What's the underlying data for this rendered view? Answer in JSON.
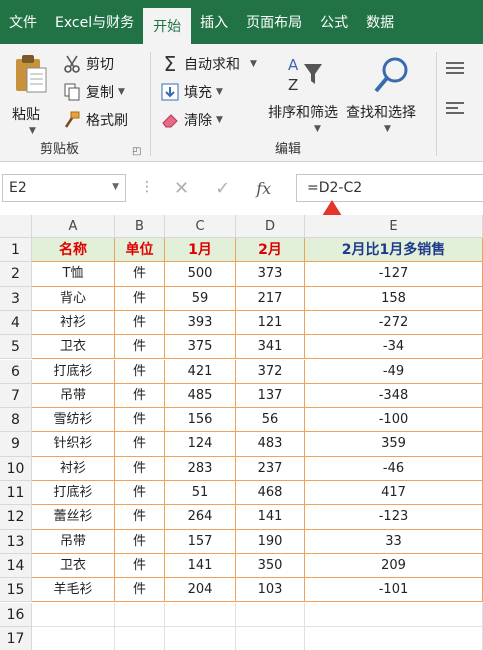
{
  "ribbon_tabs": [
    "文件",
    "Excel与财务",
    "开始",
    "插入",
    "页面布局",
    "公式",
    "数据"
  ],
  "active_tab_index": 2,
  "clipboard": {
    "paste": "粘贴",
    "cut": "剪切",
    "copy": "复制",
    "format_painter": "格式刷",
    "group_label": "剪贴板"
  },
  "editing": {
    "autosum": "自动求和",
    "fill": "填充",
    "clear": "清除",
    "sort_filter": "排序和筛选",
    "find_select": "查找和选择",
    "group_label": "编辑"
  },
  "formula_bar": {
    "name_box": "E2",
    "fx": "fx",
    "formula": "=D2-C2"
  },
  "sheet": {
    "columns": [
      "A",
      "B",
      "C",
      "D",
      "E"
    ],
    "header": [
      "名称",
      "单位",
      "1月",
      "2月",
      "2月比1月多销售"
    ],
    "rows": [
      [
        "T恤",
        "件",
        "500",
        "373",
        "-127"
      ],
      [
        "背心",
        "件",
        "59",
        "217",
        "158"
      ],
      [
        "衬衫",
        "件",
        "393",
        "121",
        "-272"
      ],
      [
        "卫衣",
        "件",
        "375",
        "341",
        "-34"
      ],
      [
        "打底衫",
        "件",
        "421",
        "372",
        "-49"
      ],
      [
        "吊带",
        "件",
        "485",
        "137",
        "-348"
      ],
      [
        "雪纺衫",
        "件",
        "156",
        "56",
        "-100"
      ],
      [
        "针织衫",
        "件",
        "124",
        "483",
        "359"
      ],
      [
        "衬衫",
        "件",
        "283",
        "237",
        "-46"
      ],
      [
        "打底衫",
        "件",
        "51",
        "468",
        "417"
      ],
      [
        "蕾丝衫",
        "件",
        "264",
        "141",
        "-123"
      ],
      [
        "吊带",
        "件",
        "157",
        "190",
        "33"
      ],
      [
        "卫衣",
        "件",
        "141",
        "350",
        "209"
      ],
      [
        "羊毛衫",
        "件",
        "204",
        "103",
        "-101"
      ]
    ],
    "row_numbers": [
      "1",
      "2",
      "3",
      "4",
      "5",
      "6",
      "7",
      "8",
      "9",
      "10",
      "11",
      "12",
      "13",
      "14",
      "15",
      "16",
      "17"
    ]
  },
  "colors": {
    "accent": "#217346",
    "header_fill": "#e2f0d9",
    "header_red": "#e00000",
    "header_blue": "#1f3c8c",
    "table_border": "#f0a15a",
    "arrow": "#e8332a"
  }
}
